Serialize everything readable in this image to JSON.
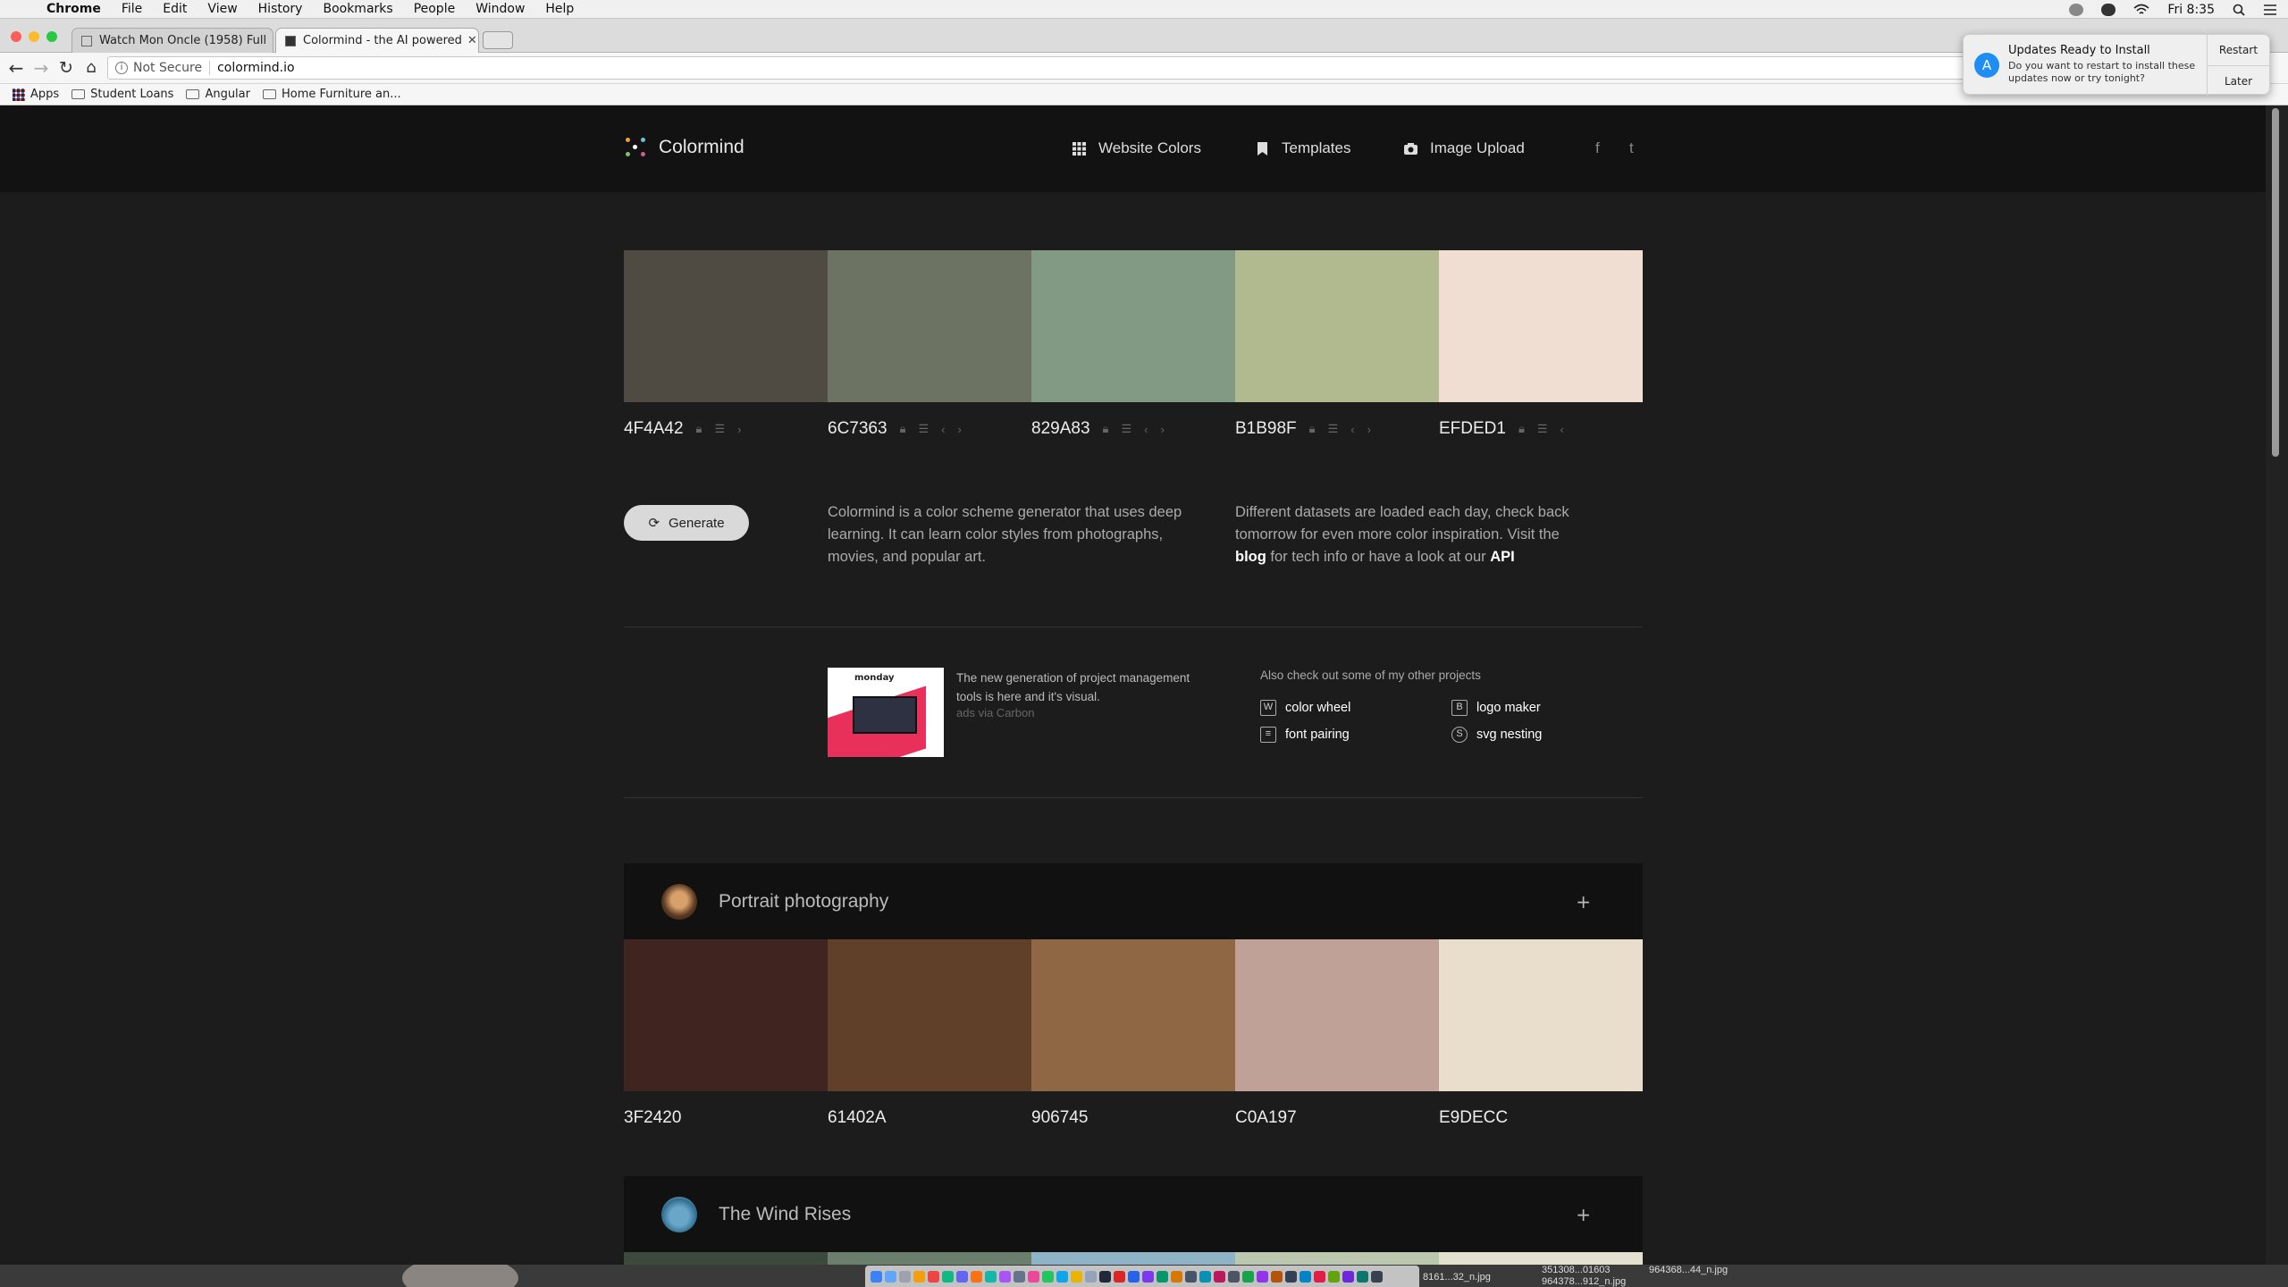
{
  "menubar": {
    "app": "Chrome",
    "items": [
      "File",
      "Edit",
      "View",
      "History",
      "Bookmarks",
      "People",
      "Window",
      "Help"
    ],
    "clock": "Fri 8:35"
  },
  "tabs": [
    {
      "title": "Watch Mon Oncle (1958) Full",
      "active": false
    },
    {
      "title": "Colormind - the AI powered",
      "active": true
    }
  ],
  "toolbar": {
    "security": "Not Secure",
    "url": "colormind.io"
  },
  "bookmarks": [
    "Apps",
    "Student Loans",
    "Angular",
    "Home Furniture an..."
  ],
  "notification": {
    "title": "Updates Ready to Install",
    "body": "Do you want to restart to install these updates now or try tonight?",
    "restart": "Restart",
    "later": "Later"
  },
  "site": {
    "brand": "Colormind",
    "nav": [
      "Website Colors",
      "Templates",
      "Image Upload"
    ],
    "social": [
      "f",
      "t"
    ]
  },
  "palette": {
    "colors": [
      "#4F4A42",
      "#6C7363",
      "#829A83",
      "#B1B98F",
      "#EFDED1"
    ],
    "hex": [
      "4F4A42",
      "6C7363",
      "829A83",
      "B1B98F",
      "EFDED1"
    ]
  },
  "generate_label": "Generate",
  "intro": "Colormind is a color scheme generator that uses deep learning. It can learn color styles from photographs, movies, and popular art.",
  "datasets": {
    "pre": "Different datasets are loaded each day, check back tomorrow for even more color inspiration. Visit the ",
    "blog": "blog",
    "mid": " for tech info or have a look at our ",
    "api": "API"
  },
  "ad": {
    "logo": "monday",
    "text": "The new generation of project management tools is here and it's visual.",
    "via": "ads via Carbon"
  },
  "projects": {
    "heading": "Also check out some of my other projects",
    "items": [
      "color wheel",
      "logo maker",
      "font pairing",
      "svg nesting"
    ]
  },
  "cards": [
    {
      "title": "Portrait photography",
      "colors": [
        "#3F2420",
        "#61402A",
        "#906745",
        "#C0A197",
        "#E9DECC"
      ],
      "hex": [
        "3F2420",
        "61402A",
        "906745",
        "C0A197",
        "E9DECC"
      ]
    },
    {
      "title": "The Wind Rises"
    }
  ],
  "desktop_files": [
    "351308...01603",
    "964378...912_n.jpg",
    "964368...44_n.jpg",
    "8161...32_n.jpg"
  ]
}
